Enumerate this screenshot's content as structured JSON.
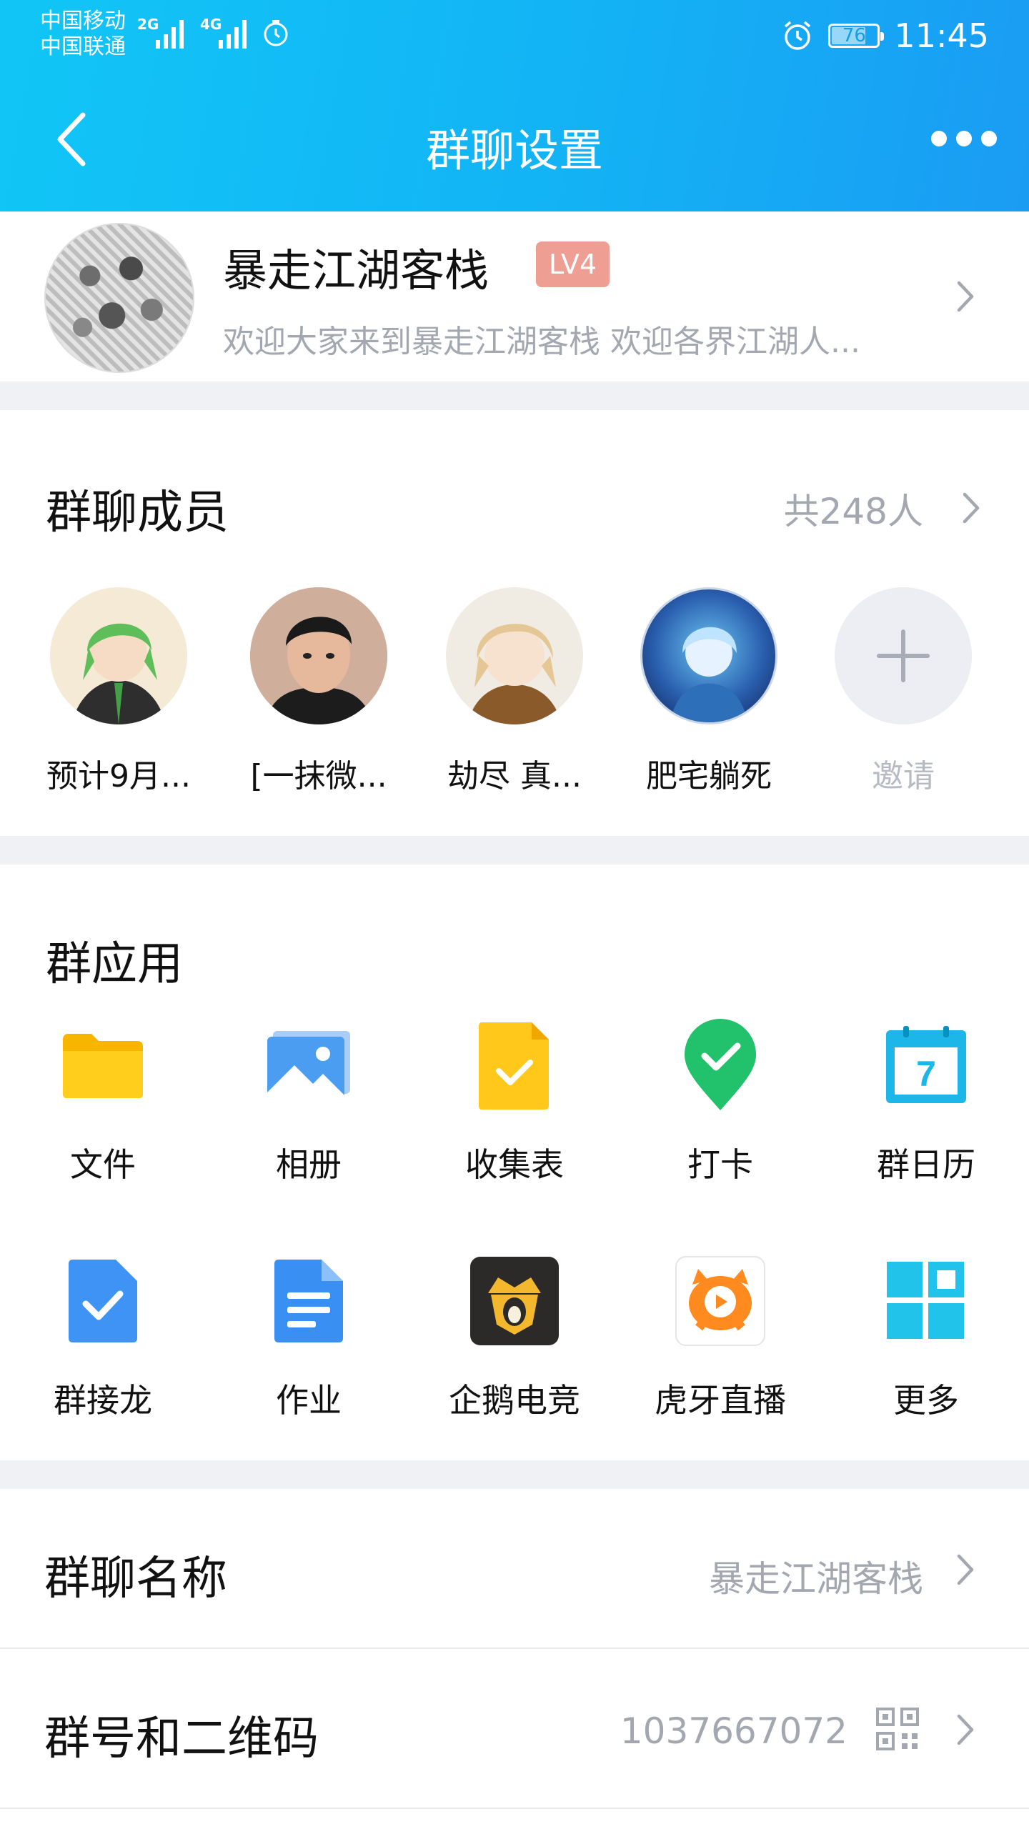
{
  "status_bar": {
    "carrier_1": "中国移动",
    "carrier_2": "中国联通",
    "signal_1": "2G",
    "signal_2": "4G",
    "battery": "76",
    "time": "11:45"
  },
  "nav": {
    "title": "群聊设置",
    "back_icon": "chevron-left-icon",
    "more_icon": "more-dots-icon"
  },
  "group": {
    "name": "暴走江湖客栈",
    "level": "LV4",
    "description": "欢迎大家来到暴走江湖客栈  欢迎各界江湖人..."
  },
  "members": {
    "title": "群聊成员",
    "count": "共248人",
    "items": [
      {
        "name": "预计9月..."
      },
      {
        "name": "[一抹微..."
      },
      {
        "name": "劫尽  真..."
      },
      {
        "name": "肥宅躺死"
      }
    ],
    "invite_label": "邀请"
  },
  "apps": {
    "title": "群应用",
    "items": [
      {
        "label": "文件",
        "icon": "folder-icon"
      },
      {
        "label": "相册",
        "icon": "photo-album-icon"
      },
      {
        "label": "收集表",
        "icon": "form-check-icon"
      },
      {
        "label": "打卡",
        "icon": "checkin-pin-icon"
      },
      {
        "label": "群日历",
        "icon": "calendar-icon"
      },
      {
        "label": "群接龙",
        "icon": "relay-doc-icon"
      },
      {
        "label": "作业",
        "icon": "homework-doc-icon"
      },
      {
        "label": "企鹅电竞",
        "icon": "penguin-esports-icon"
      },
      {
        "label": "虎牙直播",
        "icon": "huya-live-icon"
      },
      {
        "label": "更多",
        "icon": "grid-more-icon"
      }
    ],
    "calendar_day": "7"
  },
  "settings": {
    "group_name_label": "群聊名称",
    "group_name_value": "暴走江湖客栈",
    "group_id_label": "群号和二维码",
    "group_id_value": "1037667072"
  },
  "colors": {
    "header_start": "#11c6f6",
    "header_end": "#1a9cf3",
    "level_badge": "#ef9e93",
    "secondary_text": "#a3a8b0",
    "section_gap": "#f0f1f5"
  }
}
